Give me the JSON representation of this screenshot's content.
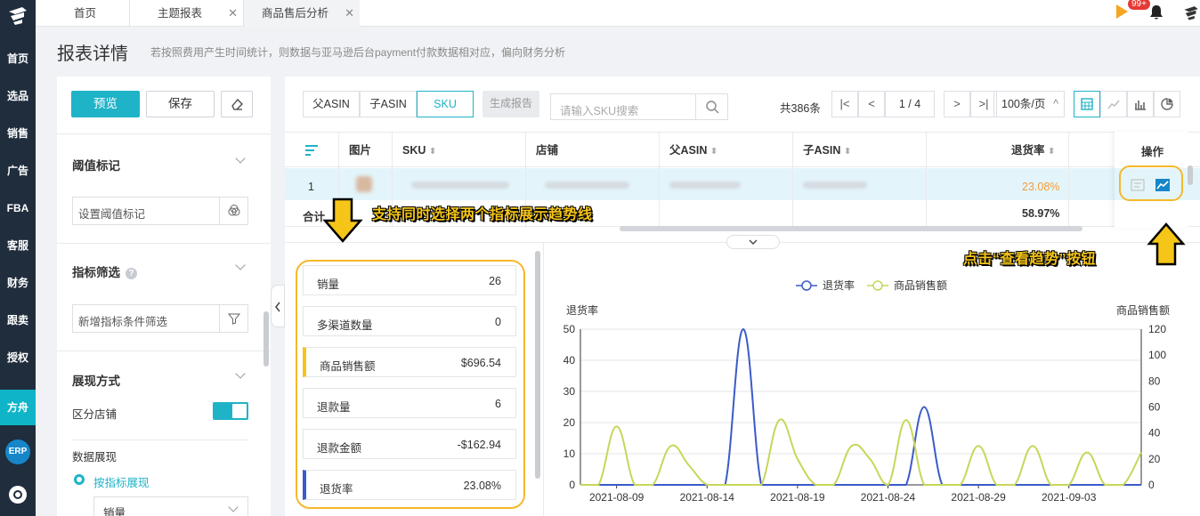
{
  "nav": {
    "items": [
      "首页",
      "选品",
      "销售",
      "广告",
      "FBA",
      "客服",
      "财务",
      "跟卖",
      "授权",
      "方舟"
    ],
    "active": "方舟",
    "erp": "ERP"
  },
  "tabs": [
    {
      "label": "首页"
    },
    {
      "label": "主题报表"
    },
    {
      "label": "商品售后分析"
    }
  ],
  "topbar": {
    "badge": "99+"
  },
  "header": {
    "title": "报表详情",
    "subtitle": "若按照费用产生时间统计，则数据与亚马逊后台payment付款数据相对应，偏向财务分析"
  },
  "left": {
    "preview": "预览",
    "save": "保存",
    "threshold_title": "阈值标记",
    "threshold_placeholder": "设置阈值标记",
    "filter_title": "指标筛选",
    "filter_placeholder": "新增指标条件筛选",
    "display_title": "展现方式",
    "split_store": "区分店铺",
    "data_display": "数据展现",
    "by_metric": "按指标展现",
    "select_value": "销量"
  },
  "toolbar": {
    "segments": [
      "父ASIN",
      "子ASIN",
      "SKU"
    ],
    "active_segment": "SKU",
    "generate": "生成报告",
    "search_placeholder": "请输入SKU搜索",
    "total": "共386条",
    "page_current": "1",
    "page_total": "/ 4",
    "page_size": "100条/页"
  },
  "table": {
    "headers": [
      "图片",
      "SKU",
      "店铺",
      "父ASIN",
      "子ASIN",
      "退货率",
      "操作"
    ],
    "row1": {
      "index": "1",
      "return_rate": "23.08%"
    },
    "row2": {
      "label": "合计",
      "return_rate": "58.97%"
    }
  },
  "metrics": [
    {
      "name": "销量",
      "value": "26"
    },
    {
      "name": "多渠道数量",
      "value": "0"
    },
    {
      "name": "商品销售额",
      "value": "$696.54"
    },
    {
      "name": "退款量",
      "value": "6"
    },
    {
      "name": "退款金额",
      "value": "-$162.94"
    },
    {
      "name": "退货率",
      "value": "23.08%"
    }
  ],
  "annotations": {
    "multi": "支持同时选择两个指标展示趋势线",
    "trend": "点击“查看趋势”按钮"
  },
  "colors": {
    "accent": "#1fb3c8",
    "series_blue": "#3b5bc9",
    "series_yellow": "#c8d65a",
    "annotation": "#f5c518"
  },
  "chart_data": {
    "type": "line",
    "x": [
      "2021-08-07",
      "2021-08-08",
      "2021-08-09",
      "2021-08-10",
      "2021-08-11",
      "2021-08-12",
      "2021-08-13",
      "2021-08-14",
      "2021-08-15",
      "2021-08-16",
      "2021-08-17",
      "2021-08-18",
      "2021-08-19",
      "2021-08-20",
      "2021-08-21",
      "2021-08-22",
      "2021-08-23",
      "2021-08-24",
      "2021-08-25",
      "2021-08-26",
      "2021-08-27",
      "2021-08-28",
      "2021-08-29",
      "2021-08-30",
      "2021-08-31",
      "2021-09-01",
      "2021-09-02",
      "2021-09-03",
      "2021-09-04",
      "2021-09-05",
      "2021-09-06",
      "2021-09-07"
    ],
    "xticks": [
      "2021-08-09",
      "2021-08-14",
      "2021-08-19",
      "2021-08-24",
      "2021-08-29",
      "2021-09-03"
    ],
    "series": [
      {
        "name": "退货率",
        "axis": "left",
        "values": [
          0,
          0,
          0,
          0,
          0,
          0,
          0,
          0,
          0,
          50,
          0,
          0,
          0,
          0,
          0,
          0,
          0,
          0,
          0,
          25,
          0,
          0,
          0,
          0,
          0,
          0,
          0,
          0,
          0,
          0,
          0,
          0
        ]
      },
      {
        "name": "商品销售额",
        "axis": "right",
        "values": [
          0,
          0,
          45,
          0,
          0,
          30,
          15,
          0,
          0,
          0,
          0,
          50,
          20,
          0,
          0,
          30,
          20,
          0,
          50,
          0,
          0,
          0,
          30,
          0,
          0,
          30,
          0,
          0,
          25,
          0,
          0,
          25
        ]
      }
    ],
    "yleft": {
      "label": "退货率",
      "ylim": [
        0,
        50
      ],
      "ticks": [
        0,
        10,
        20,
        30,
        40,
        50
      ]
    },
    "yright": {
      "label": "商品销售额",
      "ylim": [
        0,
        120
      ],
      "ticks": [
        0,
        20,
        40,
        60,
        80,
        100,
        120
      ]
    },
    "legend": "top-center",
    "grid": true
  }
}
